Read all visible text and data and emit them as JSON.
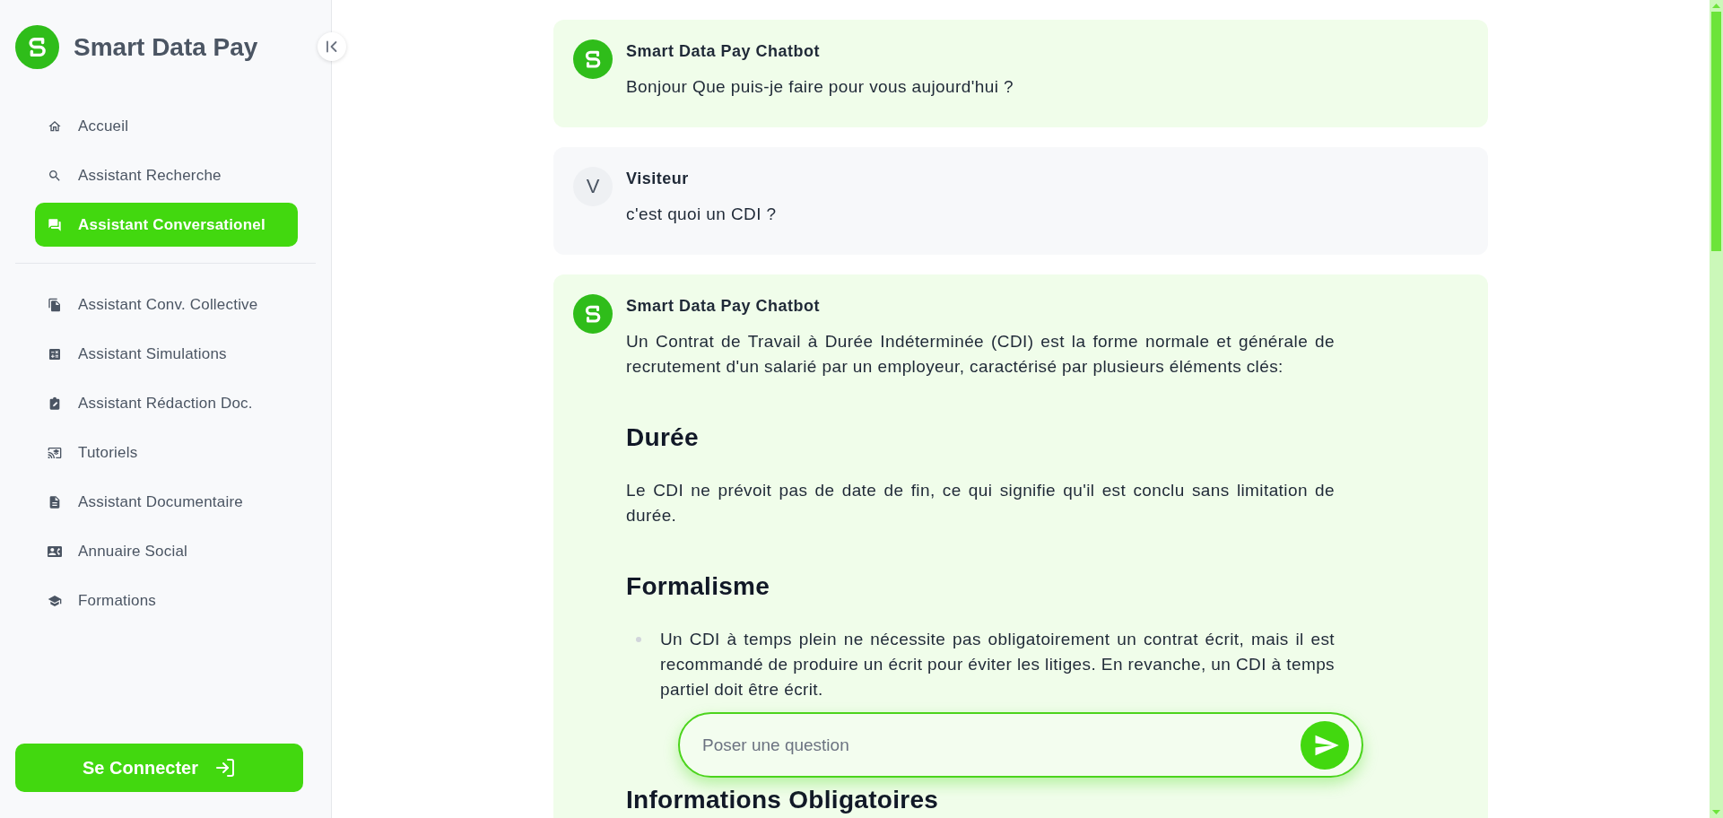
{
  "sidebar": {
    "brand": "Smart Data Pay",
    "nav_groups": [
      {
        "items": [
          {
            "label": "Accueil",
            "selected": false
          },
          {
            "label": "Assistant Recherche",
            "selected": false
          },
          {
            "label": "Assistant Conversationel",
            "selected": true
          }
        ]
      },
      {
        "items": [
          {
            "label": "Assistant Conv. Collective",
            "selected": false
          },
          {
            "label": "Assistant Simulations",
            "selected": false
          },
          {
            "label": "Assistant Rédaction Doc.",
            "selected": false
          },
          {
            "label": "Tutoriels",
            "selected": false
          },
          {
            "label": "Assistant Documentaire",
            "selected": false
          },
          {
            "label": "Annuaire Social",
            "selected": false
          },
          {
            "label": "Formations",
            "selected": false
          }
        ]
      }
    ],
    "login_button": "Se Connecter"
  },
  "chat": {
    "messages": [
      {
        "kind": "bot",
        "sender": "Smart Data Pay Chatbot",
        "blocks": [
          {
            "kind": "paragraph",
            "text": "Bonjour Que puis-je faire pour vous aujourd'hui ?"
          }
        ]
      },
      {
        "kind": "visitor",
        "sender": "Visiteur",
        "avatar": "V",
        "blocks": [
          {
            "kind": "paragraph",
            "text": "c'est quoi un CDI ?"
          }
        ]
      },
      {
        "kind": "bot",
        "sender": "Smart Data Pay Chatbot",
        "blocks": [
          {
            "kind": "paragraph",
            "text": "Un Contrat de Travail à Durée Indéterminée (CDI) est la forme normale et générale de recrutement d'un salarié par un employeur, caractérisé par plusieurs éléments clés:"
          },
          {
            "kind": "heading",
            "text": "Durée"
          },
          {
            "kind": "paragraph",
            "text": "Le CDI ne prévoit pas de date de fin, ce qui signifie qu'il est conclu sans limitation de durée."
          },
          {
            "kind": "heading",
            "text": "Formalisme"
          },
          {
            "kind": "bullets",
            "items": [
              "Un CDI à temps plein ne nécessite pas obligatoirement un contrat écrit, mais il est recommandé de produire un écrit pour éviter les litiges. En revanche, un CDI à temps partiel doit être écrit."
            ]
          },
          {
            "kind": "heading",
            "text": "Informations Obligatoires"
          }
        ]
      }
    ]
  },
  "composer": {
    "placeholder": "Poser une question"
  }
}
